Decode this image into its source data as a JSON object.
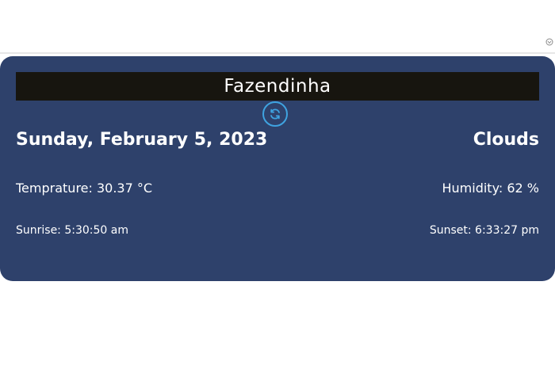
{
  "header": {
    "corner_icon": "chevron-down-icon"
  },
  "weather": {
    "location": "Fazendinha",
    "refresh_icon": "refresh-icon",
    "date": "Sunday, February 5, 2023",
    "condition": "Clouds",
    "temperature": "Temprature: 30.37 °C",
    "humidity": "Humidity: 62 %",
    "sunrise": "Sunrise: 5:30:50 am",
    "sunset": "Sunset: 6:33:27 pm"
  },
  "colors": {
    "card_background": "#2e416b",
    "location_bar": "#17150f",
    "refresh_accent": "#3fa3e0",
    "text": "#ffffff"
  }
}
